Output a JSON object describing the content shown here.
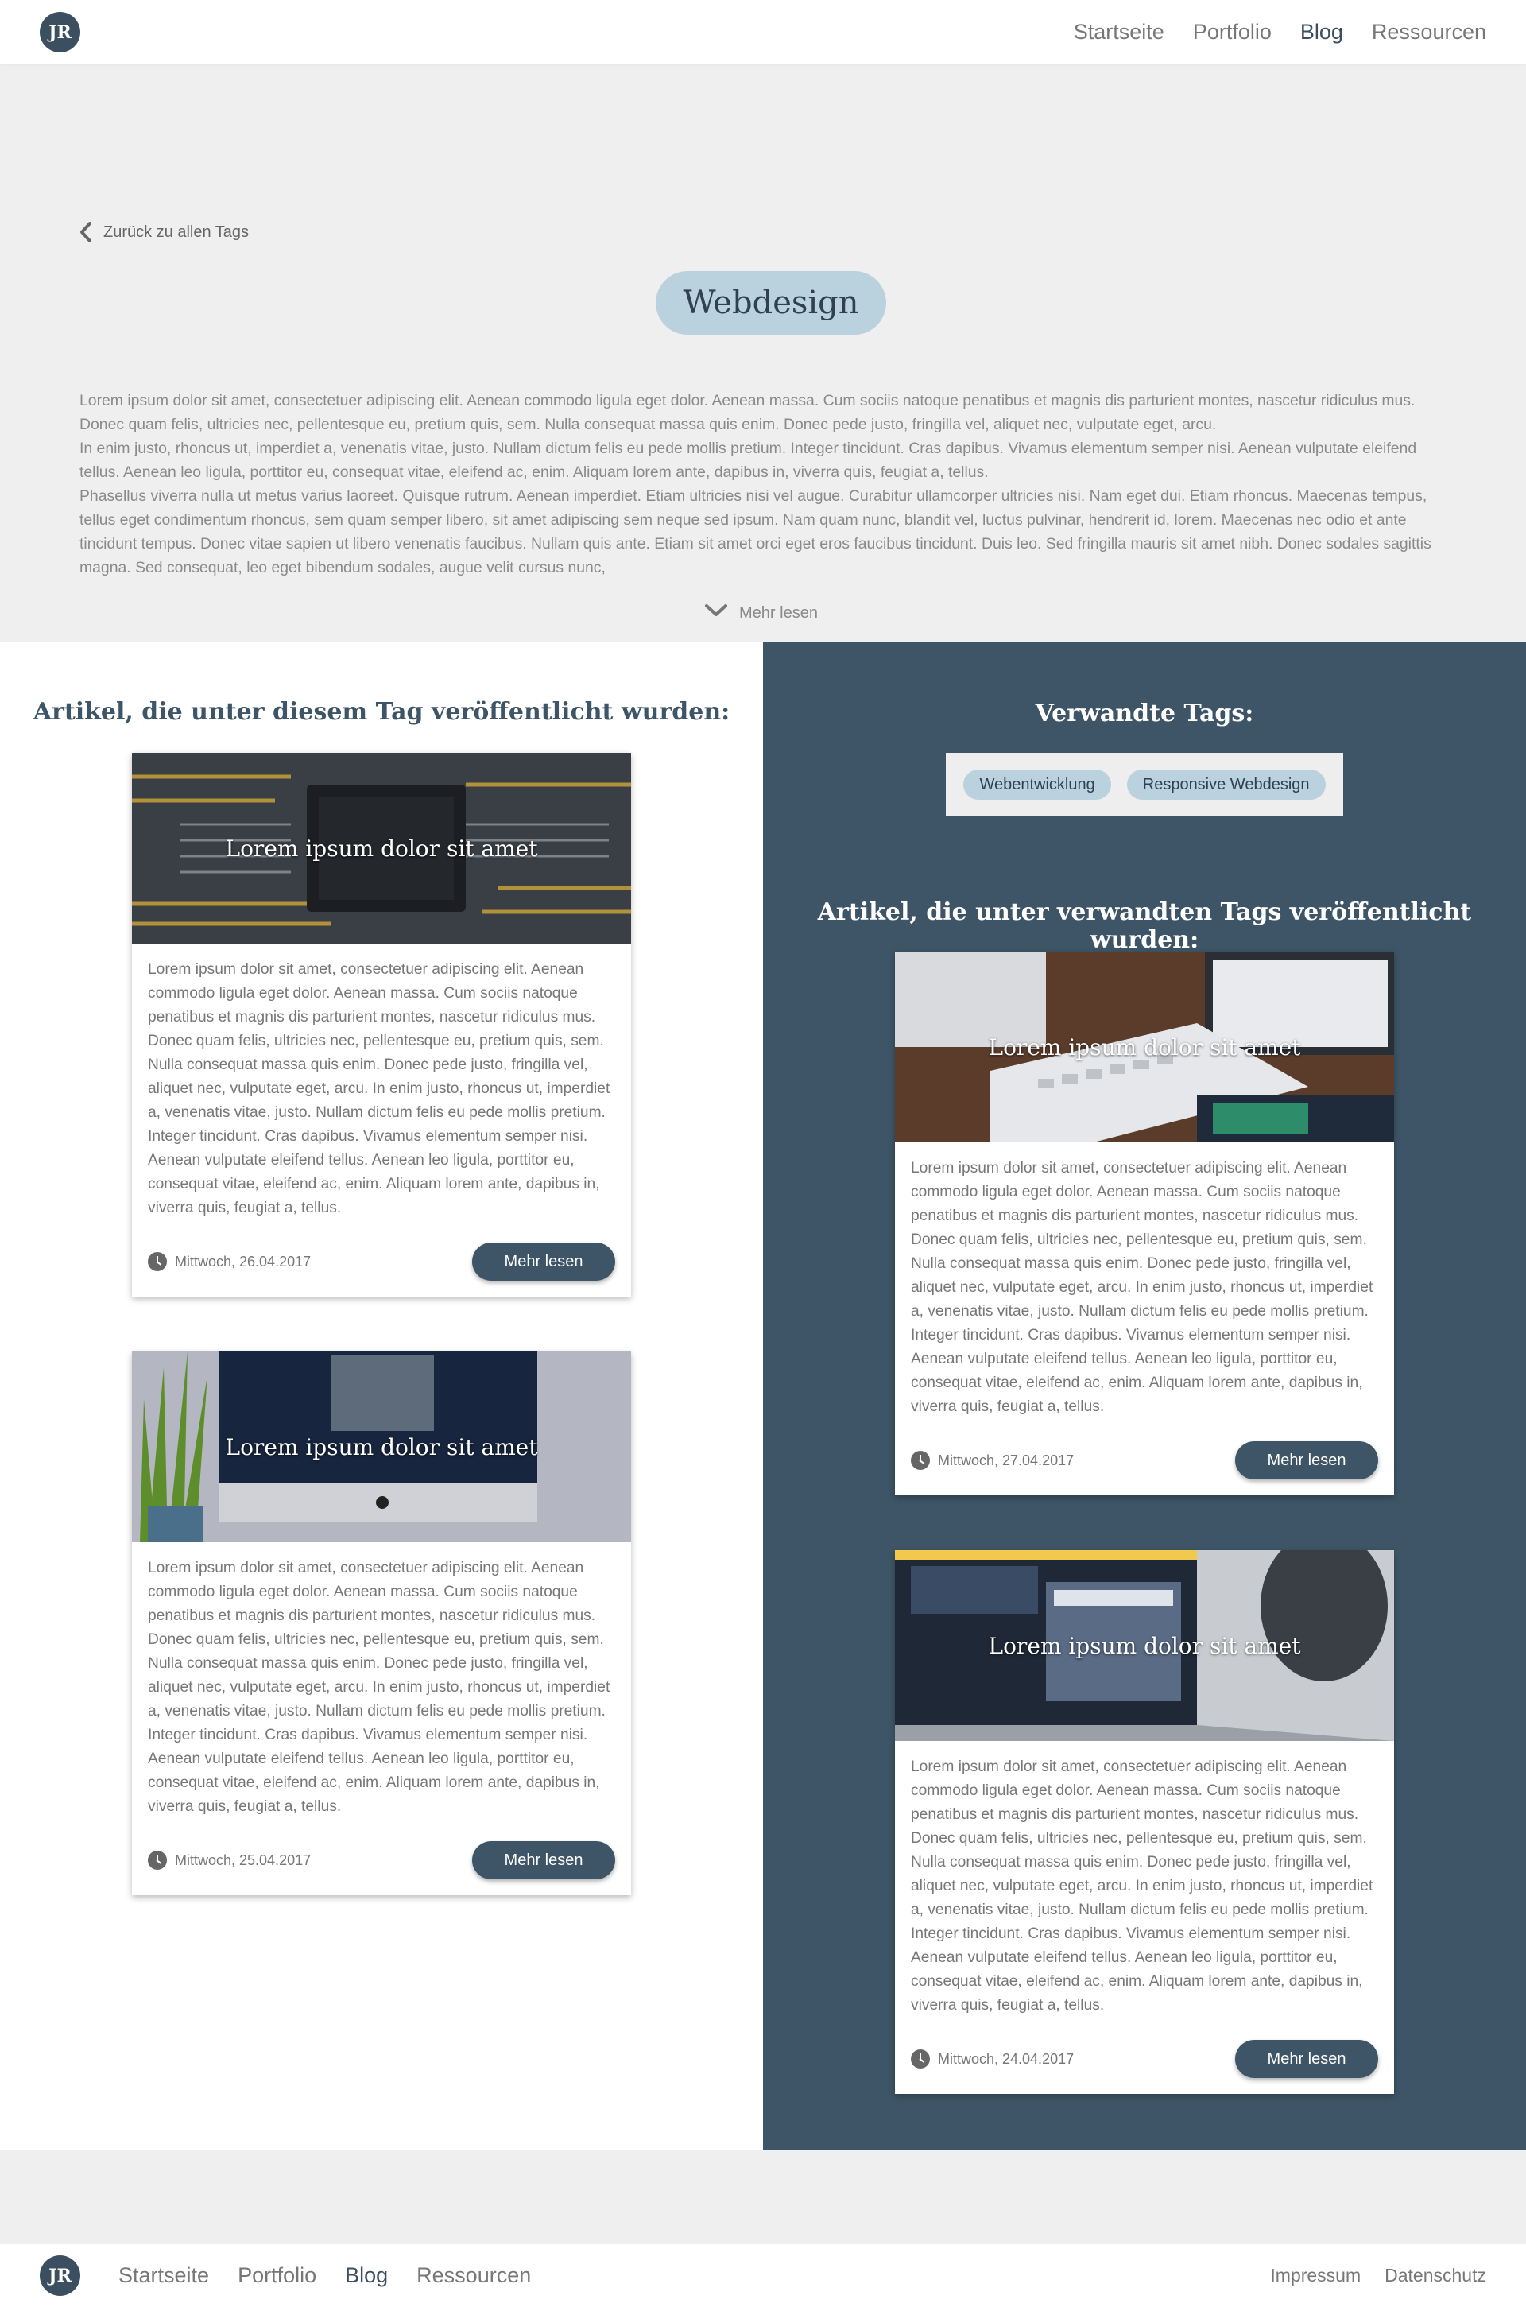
{
  "header": {
    "logo": "JR",
    "nav": [
      "Startseite",
      "Portfolio",
      "Blog",
      "Ressourcen"
    ],
    "active": "Blog"
  },
  "intro": {
    "back_label": "Zurück zu allen Tags",
    "tag": "Webdesign",
    "description": "Lorem ipsum dolor sit amet, consectetuer adipiscing elit. Aenean commodo ligula eget dolor. Aenean massa. Cum sociis natoque penatibus et magnis dis parturient montes, nascetur ridiculus mus. Donec quam felis, ultricies nec, pellentesque eu, pretium quis, sem. Nulla consequat massa quis enim. Donec pede justo, fringilla vel, aliquet nec, vulputate eget, arcu.\nIn enim justo, rhoncus ut, imperdiet a, venenatis vitae, justo. Nullam dictum felis eu pede mollis pretium. Integer tincidunt. Cras dapibus. Vivamus elementum semper nisi. Aenean vulputate eleifend tellus. Aenean leo ligula, porttitor eu, consequat vitae, eleifend ac, enim. Aliquam lorem ante, dapibus in, viverra quis, feugiat a, tellus.\nPhasellus viverra nulla ut metus varius laoreet. Quisque rutrum. Aenean imperdiet. Etiam ultricies nisi vel augue. Curabitur ullamcorper ultricies nisi. Nam eget dui. Etiam rhoncus. Maecenas tempus, tellus eget condimentum rhoncus, sem quam semper libero, sit amet adipiscing sem neque sed ipsum. Nam quam nunc, blandit vel, luctus pulvinar, hendrerit id, lorem. Maecenas nec odio et ante tincidunt tempus. Donec vitae sapien ut libero venenatis faucibus. Nullam quis ante. Etiam sit amet orci eget eros faucibus tincidunt. Duis leo. Sed fringilla mauris sit amet nibh. Donec sodales sagittis magna. Sed consequat, leo eget bibendum sodales, augue velit cursus nunc,",
    "more_label": "Mehr lesen"
  },
  "left": {
    "title": "Artikel, die unter diesem Tag veröffentlicht wurden:",
    "cards": [
      {
        "title": "Lorem ipsum dolor sit amet",
        "body": "Lorem ipsum dolor sit amet, consectetuer adipiscing elit. Aenean commodo ligula eget dolor. Aenean massa. Cum sociis natoque penatibus et magnis dis parturient montes, nascetur ridiculus mus. Donec quam felis, ultricies nec, pellentesque eu, pretium quis, sem. Nulla consequat massa quis enim. Donec pede justo, fringilla vel, aliquet nec, vulputate eget, arcu. In enim justo, rhoncus ut, imperdiet a, venenatis vitae, justo. Nullam dictum felis eu pede mollis pretium. Integer tincidunt. Cras dapibus. Vivamus elementum semper nisi. Aenean vulputate eleifend tellus. Aenean leo ligula, porttitor eu, consequat vitae, eleifend ac, enim. Aliquam lorem ante, dapibus in, viverra quis, feugiat a, tellus.",
        "date": "Mittwoch, 26.04.2017",
        "button": "Mehr lesen"
      },
      {
        "title": "Lorem ipsum dolor sit amet",
        "body": "Lorem ipsum dolor sit amet, consectetuer adipiscing elit. Aenean commodo ligula eget dolor. Aenean massa. Cum sociis natoque penatibus et magnis dis parturient montes, nascetur ridiculus mus. Donec quam felis, ultricies nec, pellentesque eu, pretium quis, sem. Nulla consequat massa quis enim. Donec pede justo, fringilla vel, aliquet nec, vulputate eget, arcu. In enim justo, rhoncus ut, imperdiet a, venenatis vitae, justo. Nullam dictum felis eu pede mollis pretium. Integer tincidunt. Cras dapibus. Vivamus elementum semper nisi. Aenean vulputate eleifend tellus. Aenean leo ligula, porttitor eu, consequat vitae, eleifend ac, enim. Aliquam lorem ante, dapibus in, viverra quis, feugiat a, tellus.",
        "date": "Mittwoch, 25.04.2017",
        "button": "Mehr lesen"
      }
    ]
  },
  "right": {
    "related_title": "Verwandte Tags:",
    "related_tags": [
      "Webentwicklung",
      "Responsive Webdesign"
    ],
    "title": "Artikel, die unter verwandten Tags veröffentlicht wurden:",
    "cards": [
      {
        "title": "Lorem ipsum dolor sit amet",
        "body": "Lorem ipsum dolor sit amet, consectetuer adipiscing elit. Aenean commodo ligula eget dolor. Aenean massa. Cum sociis natoque penatibus et magnis dis parturient montes, nascetur ridiculus mus. Donec quam felis, ultricies nec, pellentesque eu, pretium quis, sem. Nulla consequat massa quis enim. Donec pede justo, fringilla vel, aliquet nec, vulputate eget, arcu. In enim justo, rhoncus ut, imperdiet a, venenatis vitae, justo. Nullam dictum felis eu pede mollis pretium. Integer tincidunt. Cras dapibus. Vivamus elementum semper nisi. Aenean vulputate eleifend tellus. Aenean leo ligula, porttitor eu, consequat vitae, eleifend ac, enim. Aliquam lorem ante, dapibus in, viverra quis, feugiat a, tellus.",
        "date": "Mittwoch, 27.04.2017",
        "button": "Mehr lesen"
      },
      {
        "title": "Lorem ipsum dolor sit amet",
        "body": "Lorem ipsum dolor sit amet, consectetuer adipiscing elit. Aenean commodo ligula eget dolor. Aenean massa. Cum sociis natoque penatibus et magnis dis parturient montes, nascetur ridiculus mus. Donec quam felis, ultricies nec, pellentesque eu, pretium quis, sem. Nulla consequat massa quis enim. Donec pede justo, fringilla vel, aliquet nec, vulputate eget, arcu. In enim justo, rhoncus ut, imperdiet a, venenatis vitae, justo. Nullam dictum felis eu pede mollis pretium. Integer tincidunt. Cras dapibus. Vivamus elementum semper nisi. Aenean vulputate eleifend tellus. Aenean leo ligula, porttitor eu, consequat vitae, eleifend ac, enim. Aliquam lorem ante, dapibus in, viverra quis, feugiat a, tellus.",
        "date": "Mittwoch, 24.04.2017",
        "button": "Mehr lesen"
      }
    ]
  },
  "footer": {
    "logo": "JR",
    "nav": [
      "Startseite",
      "Portfolio",
      "Blog",
      "Ressourcen"
    ],
    "legal": [
      "Impressum",
      "Datenschutz"
    ]
  },
  "colors": {
    "accent": "#3d5566",
    "tag_pill": "#b9d2dd",
    "page_bg": "#efefef"
  }
}
